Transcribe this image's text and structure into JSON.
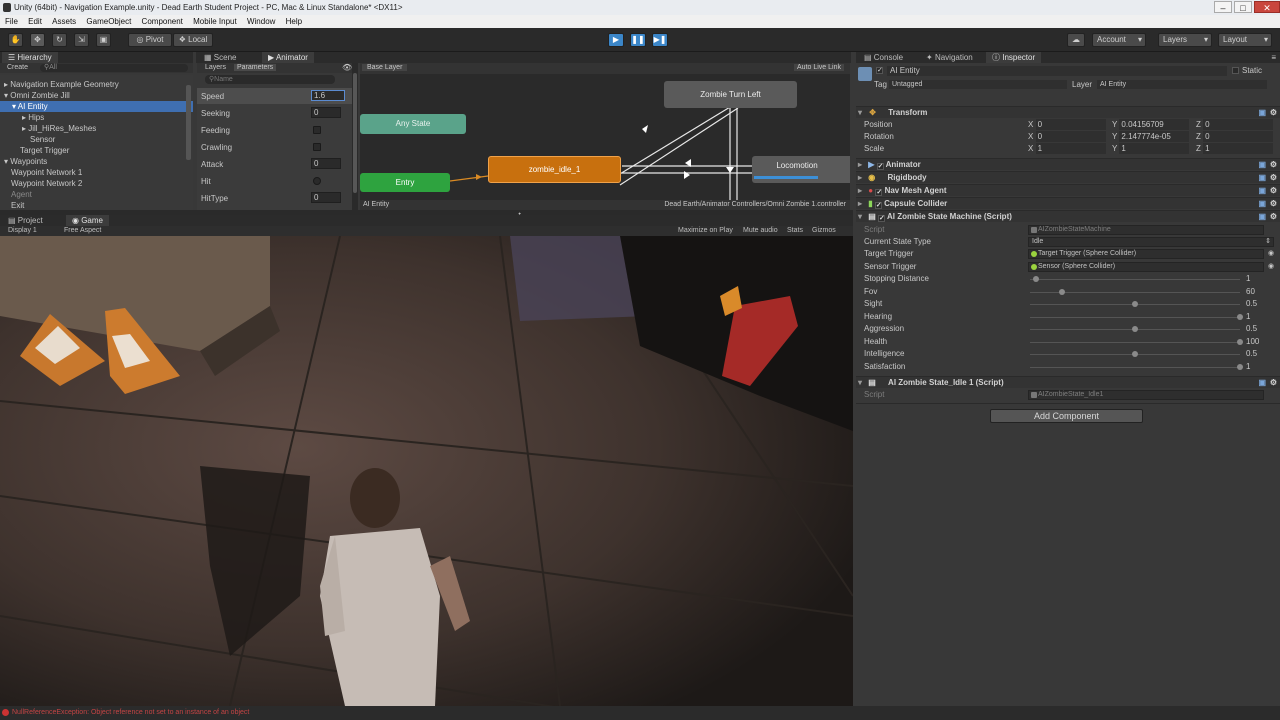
{
  "window": {
    "title": "Unity (64bit) - Navigation Example.unity - Dead Earth Student Project - PC, Mac & Linux Standalone* <DX11>",
    "minimize": "–",
    "maximize": "□",
    "close": "✕"
  },
  "menu": [
    "File",
    "Edit",
    "Assets",
    "GameObject",
    "Component",
    "Mobile Input",
    "Window",
    "Help"
  ],
  "toolbar": {
    "pivot": "Pivot",
    "local": "Local",
    "account": "Account",
    "layers": "Layers",
    "layout": "Layout"
  },
  "hierarchy": {
    "tab": "Hierarchy",
    "create": "Create",
    "search_placeholder": "All",
    "items": [
      "Navigation Example Geometry",
      "Omni Zombie Jill",
      "AI Entity",
      "Hips",
      "Jill_HiRes_Meshes",
      "Sensor",
      "Target Trigger",
      "Waypoints",
      "Waypoint Network 1",
      "Waypoint Network 2",
      "Agent",
      "Exit"
    ]
  },
  "animator": {
    "scene_tab": "Scene",
    "animator_tab": "Animator",
    "layers_tab": "Layers",
    "parameters_tab": "Parameters",
    "search_placeholder": "Name",
    "base_layer": "Base Layer",
    "auto_live_link": "Auto Live Link",
    "footer_left": "AI Entity",
    "footer_right": "Dead Earth/Animator Controllers/Omni Zombie 1.controller",
    "parameters": [
      {
        "name": "Speed",
        "value": "1.6"
      },
      {
        "name": "Seeking",
        "value": "0"
      },
      {
        "name": "Feeding",
        "value": ""
      },
      {
        "name": "Crawling",
        "value": ""
      },
      {
        "name": "Attack",
        "value": "0"
      },
      {
        "name": "Hit",
        "value": ""
      },
      {
        "name": "HitType",
        "value": "0"
      }
    ],
    "nodes": {
      "any_state": "Any State",
      "entry": "Entry",
      "idle": "zombie_idle_1",
      "turn_left": "Zombie Turn Left",
      "locomotion": "Locomotion"
    }
  },
  "game": {
    "project_tab": "Project",
    "game_tab": "Game",
    "display": "Display 1",
    "aspect": "Free Aspect",
    "maximize_on_play": "Maximize on Play",
    "mute_audio": "Mute audio",
    "stats": "Stats",
    "gizmos": "Gizmos"
  },
  "inspector": {
    "console_tab": "Console",
    "navigation_tab": "Navigation",
    "inspector_tab": "Inspector",
    "object_name": "AI Entity",
    "static": "Static",
    "tag_label": "Tag",
    "tag_value": "Untagged",
    "layer_label": "Layer",
    "layer_value": "AI Entity",
    "transform": {
      "title": "Transform",
      "position": {
        "label": "Position",
        "x": "0",
        "y": "0.04156709",
        "z": "0"
      },
      "rotation": {
        "label": "Rotation",
        "x": "0",
        "y": "2.147774e-05",
        "z": "0"
      },
      "scale": {
        "label": "Scale",
        "x": "1",
        "y": "1",
        "z": "1"
      }
    },
    "components": [
      "Animator",
      "Rigidbody",
      "Nav Mesh Agent",
      "Capsule Collider",
      "AI Zombie State Machine (Script)"
    ],
    "state_machine": {
      "script_label": "Script",
      "script_value": "AIZombieStateMachine",
      "current_state_label": "Current State Type",
      "current_state_value": "Idle",
      "target_trigger_label": "Target Trigger",
      "target_trigger_value": "Target Trigger (Sphere Collider)",
      "sensor_trigger_label": "Sensor Trigger",
      "sensor_trigger_value": "Sensor (Sphere Collider)",
      "sliders": [
        {
          "label": "Stopping Distance",
          "value": "1",
          "fraction": 0.03
        },
        {
          "label": "Fov",
          "value": "60",
          "fraction": 0.15
        },
        {
          "label": "Sight",
          "value": "0.5",
          "fraction": 0.5
        },
        {
          "label": "Hearing",
          "value": "1",
          "fraction": 1.0
        },
        {
          "label": "Aggression",
          "value": "0.5",
          "fraction": 0.5
        },
        {
          "label": "Health",
          "value": "100",
          "fraction": 1.0
        },
        {
          "label": "Intelligence",
          "value": "0.5",
          "fraction": 0.5
        },
        {
          "label": "Satisfaction",
          "value": "1",
          "fraction": 1.0
        }
      ]
    },
    "idle_state": {
      "title": "AI Zombie State_Idle 1 (Script)",
      "script_label": "Script",
      "script_value": "AIZombieState_Idle1"
    },
    "add_component": "Add Component"
  },
  "status": "NullReferenceException: Object reference not set to an instance of an object"
}
